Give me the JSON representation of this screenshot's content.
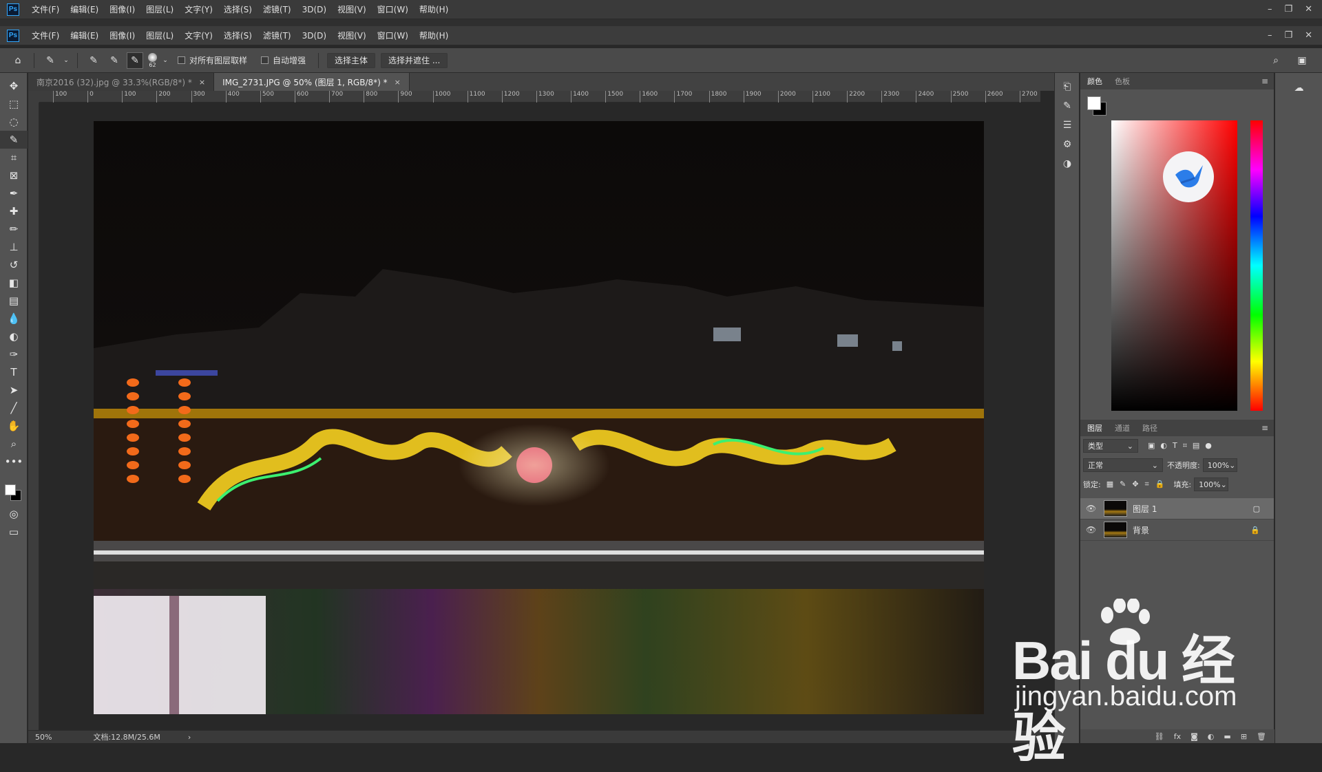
{
  "app": {
    "logo": "Ps"
  },
  "menu": [
    "文件(F)",
    "编辑(E)",
    "图像(I)",
    "图层(L)",
    "文字(Y)",
    "选择(S)",
    "滤镜(T)",
    "3D(D)",
    "视图(V)",
    "窗口(W)",
    "帮助(H)"
  ],
  "window_controls": {
    "minimize": "–",
    "restore": "❐",
    "close": "✕"
  },
  "options": {
    "brush_size": "62",
    "sample_all_layers": "对所有图层取样",
    "auto_enhance": "自动增强",
    "select_subject": "选择主体",
    "select_and_mask": "选择并遮住 ..."
  },
  "tabs": [
    {
      "label": "南京2016 (32).jpg @ 33.3%(RGB/8*) *",
      "close": "×"
    },
    {
      "label": "IMG_2731.JPG @ 50% (图层 1, RGB/8*) *",
      "close": "×"
    }
  ],
  "ruler_labels": [
    "100",
    "0",
    "100",
    "200",
    "300",
    "400",
    "500",
    "600",
    "700",
    "800",
    "900",
    "1000",
    "1100",
    "1200",
    "1300",
    "1400",
    "1500",
    "1600",
    "1700",
    "1800",
    "1900",
    "2000",
    "2100",
    "2200",
    "2300",
    "2400",
    "2500",
    "2600",
    "2700"
  ],
  "status": {
    "zoom": "50%",
    "doc": "文档:12.8M/25.6M",
    "arrow": "›"
  },
  "color_panel": {
    "tabs": [
      "颜色",
      "色板"
    ],
    "accent": "#ff0000"
  },
  "layers_panel": {
    "tabs": [
      "图层",
      "通道",
      "路径"
    ],
    "filter": "类型",
    "blend_mode": "正常",
    "opacity_label": "不透明度:",
    "opacity_value": "100%",
    "lock_label": "锁定:",
    "fill_label": "填充:",
    "fill_value": "100%",
    "layers": [
      {
        "name": "图层 1",
        "selected": true
      },
      {
        "name": "背景",
        "selected": false
      }
    ],
    "footer_fx": "fx"
  },
  "watermark": {
    "logo": "Bai du 经验",
    "url": "jingyan.baidu.com"
  }
}
